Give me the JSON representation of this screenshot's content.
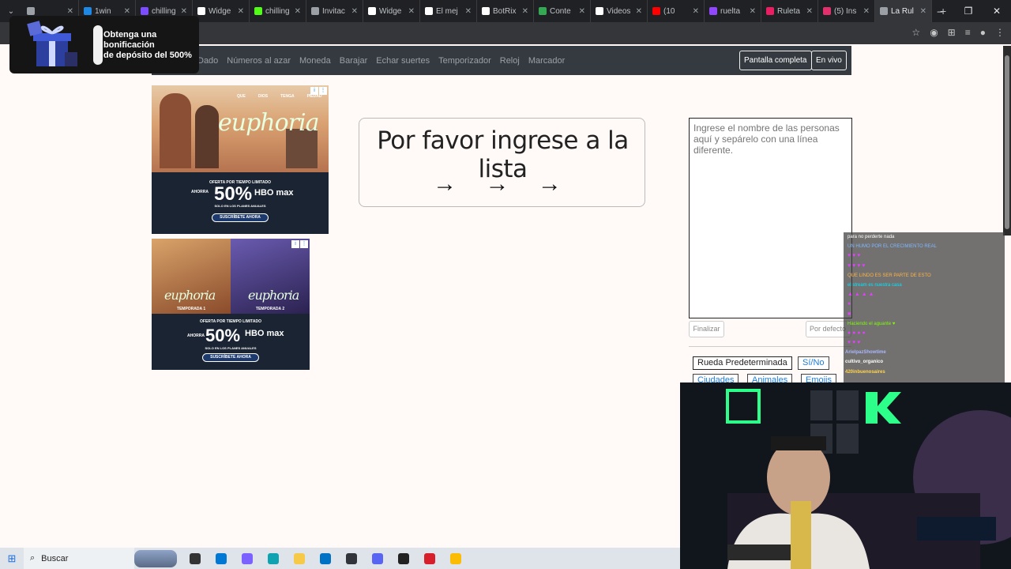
{
  "browser": {
    "tabs": [
      {
        "label": "",
        "color": "#9aa0a6"
      },
      {
        "label": "1win",
        "color": "#1e88e5"
      },
      {
        "label": "chilling",
        "color": "#7c4dff"
      },
      {
        "label": "Widge",
        "color": "#ffffff"
      },
      {
        "label": "chilling",
        "color": "#53fc18"
      },
      {
        "label": "Invitac",
        "color": "#9aa0a6"
      },
      {
        "label": "Widge",
        "color": "#ffffff"
      },
      {
        "label": "El mej",
        "color": "#ffffff"
      },
      {
        "label": "BotRix",
        "color": "#ffffff"
      },
      {
        "label": "Conte",
        "color": "#34a853"
      },
      {
        "label": "Videos",
        "color": "#ffffff"
      },
      {
        "label": "(10",
        "color": "#ff0000"
      },
      {
        "label": "ruelta",
        "color": "#9146ff"
      },
      {
        "label": "Ruleta",
        "color": "#e91e63"
      },
      {
        "label": "(5) Ins",
        "color": "#e1306c"
      },
      {
        "label": "La Rul",
        "color": "#9aa0a6",
        "active": true
      }
    ],
    "new_tab": "+",
    "win_controls": [
      "⌄",
      "–",
      "❐",
      "✕"
    ]
  },
  "promo": {
    "text_line1": "Obtenga una",
    "text_line2": "bonificación",
    "text_line3": "de depósito del 500%"
  },
  "nav": {
    "links": [
      "Dado",
      "Números al azar",
      "Moneda",
      "Barajar",
      "Echar suertes",
      "Temporizador",
      "Reloj",
      "Marcador"
    ],
    "fullscreen": "Pantalla completa",
    "live": "En vivo"
  },
  "ad1": {
    "brand": "euphoria",
    "band_top": "OFERTA POR TIEMPO LIMITADO",
    "now": "AHORRA",
    "discount": "50%",
    "plan": "SOLO EN LOS PLANES ANUALES",
    "service": "HBO max",
    "cta": "SUSCRÍBETE AHORA",
    "tags": [
      "QUE",
      "DIOS",
      "TENGA",
      "PIEDAD"
    ]
  },
  "ad2": {
    "season1": "TEMPORADA 1",
    "season2": "TEMPORADA 2",
    "brand": "euphoria",
    "band_top": "OFERTA POR TIEMPO LIMITADO",
    "now": "AHORRA",
    "discount": "50%",
    "plan": "SOLO EN LOS PLANES ANUALES",
    "service": "HBO max",
    "cta": "SUSCRÍBETE AHORA"
  },
  "main": {
    "title": "Por favor ingrese a la lista",
    "arrows": "→ → →"
  },
  "names_input": {
    "placeholder": "Ingrese el nombre de las personas aquí y sepárelo con una línea diferente.",
    "finish": "Finalizar",
    "default": "Por defecto"
  },
  "presets": [
    "Rueda Predeterminada",
    "Sí/No",
    "Ciudades",
    "Animales",
    "Emojis"
  ],
  "chat": [
    {
      "user": "",
      "msg": "para no perderte nada",
      "color": "#ffffff"
    },
    {
      "user": "",
      "msg": "UN HUMO POR EL CRECIMIENTO REAL",
      "color": "#7fb8ff"
    },
    {
      "user": "",
      "msg": "♥ ♥ ♥",
      "color": "#7cfc00",
      "emote": true
    },
    {
      "user": "",
      "msg": "♥ ♥ ♥ ♥",
      "color": "#ff66cc",
      "emote": true
    },
    {
      "user": "",
      "msg": "QUE LINDO ES SER PARTE DE ESTO",
      "color": "#ffb347"
    },
    {
      "user": "",
      "msg": "el stream es nuestra casa",
      "color": "#00e5ff"
    },
    {
      "user": "",
      "msg": "▲ ▲ ▲ ▲",
      "color": "#bbbbbb",
      "emote": true
    },
    {
      "user": "",
      "msg": "●",
      "color": "#ffa726",
      "emote": true
    },
    {
      "user": "",
      "msg": "■",
      "color": "#ffffff",
      "emote": true
    },
    {
      "user": "",
      "msg": "Haciendo el aguante ♥",
      "color": "#7cfc00"
    },
    {
      "user": "",
      "msg": "● ● ● ●",
      "color": "#bbbbbb",
      "emote": true
    },
    {
      "user": "",
      "msg": "♥ ♥ ♥",
      "color": "#7cfc00",
      "emote": true
    },
    {
      "user": "ArielpazShowtime",
      "msg": "",
      "color": "#aab7ff"
    },
    {
      "user": "cultivo_organico",
      "msg": "",
      "color": "#ffffff"
    },
    {
      "user": "420inbuenosaires",
      "msg": "",
      "color": "#ffd54f"
    }
  ],
  "taskbar": {
    "search": "Buscar",
    "apps": [
      {
        "name": "task-view-icon",
        "color": "#333333"
      },
      {
        "name": "store-icon",
        "color": "#0078d4"
      },
      {
        "name": "copilot-icon",
        "color": "#7b61ff"
      },
      {
        "name": "edge-icon",
        "color": "#0fa3b1"
      },
      {
        "name": "explorer-icon",
        "color": "#f7c948"
      },
      {
        "name": "outlook-icon",
        "color": "#0072c6"
      },
      {
        "name": "streamlabs-icon",
        "color": "#31343b"
      },
      {
        "name": "discord-icon",
        "color": "#5865f2"
      },
      {
        "name": "obs-icon",
        "color": "#222222"
      },
      {
        "name": "opera-icon",
        "color": "#d61f2b"
      },
      {
        "name": "chrome-icon",
        "color": "#fbbc05"
      }
    ]
  }
}
